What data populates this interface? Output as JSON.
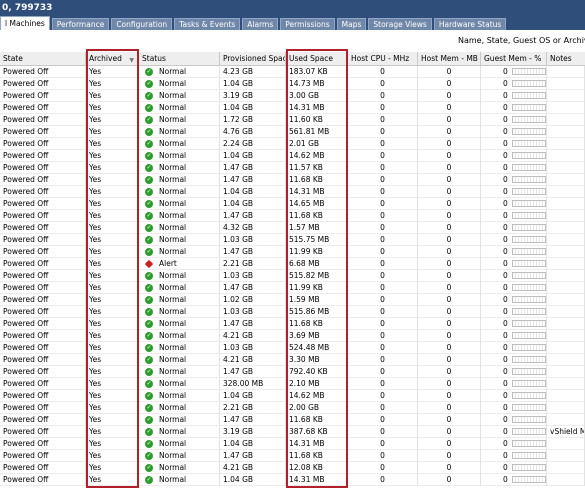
{
  "window": {
    "title": "0, 799733"
  },
  "tabs": [
    {
      "label": "l Machines",
      "active": true
    },
    {
      "label": "Performance",
      "active": false
    },
    {
      "label": "Configuration",
      "active": false
    },
    {
      "label": "Tasks & Events",
      "active": false
    },
    {
      "label": "Alarms",
      "active": false
    },
    {
      "label": "Permissions",
      "active": false
    },
    {
      "label": "Maps",
      "active": false
    },
    {
      "label": "Storage Views",
      "active": false
    },
    {
      "label": "Hardware Status",
      "active": false
    }
  ],
  "filter": {
    "label": "Name, State, Guest OS or Archived co"
  },
  "columns": {
    "state": "State",
    "archived": "Archived",
    "status": "Status",
    "provisioned": "Provisioned Space",
    "used": "Used Space",
    "hostcpu": "Host CPU - MHz",
    "hostmem": "Host Mem - MB",
    "guestmem": "Guest Mem - %",
    "notes": "Notes"
  },
  "rows": [
    {
      "state": "Powered Off",
      "archived": "Yes",
      "status": "Normal",
      "provisioned": "4.23 GB",
      "used": "183.07 KB",
      "hostcpu": "0",
      "hostmem": "0",
      "guestmem": "0",
      "notes": ""
    },
    {
      "state": "Powered Off",
      "archived": "Yes",
      "status": "Normal",
      "provisioned": "1.04 GB",
      "used": "14.73 MB",
      "hostcpu": "0",
      "hostmem": "0",
      "guestmem": "0",
      "notes": ""
    },
    {
      "state": "Powered Off",
      "archived": "Yes",
      "status": "Normal",
      "provisioned": "3.19 GB",
      "used": "3.00 GB",
      "hostcpu": "0",
      "hostmem": "0",
      "guestmem": "0",
      "notes": ""
    },
    {
      "state": "Powered Off",
      "archived": "Yes",
      "status": "Normal",
      "provisioned": "1.04 GB",
      "used": "14.31 MB",
      "hostcpu": "0",
      "hostmem": "0",
      "guestmem": "0",
      "notes": ""
    },
    {
      "state": "Powered Off",
      "archived": "Yes",
      "status": "Normal",
      "provisioned": "1.72 GB",
      "used": "11.60 KB",
      "hostcpu": "0",
      "hostmem": "0",
      "guestmem": "0",
      "notes": ""
    },
    {
      "state": "Powered Off",
      "archived": "Yes",
      "status": "Normal",
      "provisioned": "4.76 GB",
      "used": "561.81 MB",
      "hostcpu": "0",
      "hostmem": "0",
      "guestmem": "0",
      "notes": ""
    },
    {
      "state": "Powered Off",
      "archived": "Yes",
      "status": "Normal",
      "provisioned": "2.24 GB",
      "used": "2.01 GB",
      "hostcpu": "0",
      "hostmem": "0",
      "guestmem": "0",
      "notes": ""
    },
    {
      "state": "Powered Off",
      "archived": "Yes",
      "status": "Normal",
      "provisioned": "1.04 GB",
      "used": "14.62 MB",
      "hostcpu": "0",
      "hostmem": "0",
      "guestmem": "0",
      "notes": ""
    },
    {
      "state": "Powered Off",
      "archived": "Yes",
      "status": "Normal",
      "provisioned": "1.47 GB",
      "used": "11.57 KB",
      "hostcpu": "0",
      "hostmem": "0",
      "guestmem": "0",
      "notes": ""
    },
    {
      "state": "Powered Off",
      "archived": "Yes",
      "status": "Normal",
      "provisioned": "1.47 GB",
      "used": "11.68 KB",
      "hostcpu": "0",
      "hostmem": "0",
      "guestmem": "0",
      "notes": ""
    },
    {
      "state": "Powered Off",
      "archived": "Yes",
      "status": "Normal",
      "provisioned": "1.04 GB",
      "used": "14.31 MB",
      "hostcpu": "0",
      "hostmem": "0",
      "guestmem": "0",
      "notes": ""
    },
    {
      "state": "Powered Off",
      "archived": "Yes",
      "status": "Normal",
      "provisioned": "1.04 GB",
      "used": "14.65 MB",
      "hostcpu": "0",
      "hostmem": "0",
      "guestmem": "0",
      "notes": ""
    },
    {
      "state": "Powered Off",
      "archived": "Yes",
      "status": "Normal",
      "provisioned": "1.47 GB",
      "used": "11.68 KB",
      "hostcpu": "0",
      "hostmem": "0",
      "guestmem": "0",
      "notes": ""
    },
    {
      "state": "Powered Off",
      "archived": "Yes",
      "status": "Normal",
      "provisioned": "4.32 GB",
      "used": "1.57 MB",
      "hostcpu": "0",
      "hostmem": "0",
      "guestmem": "0",
      "notes": ""
    },
    {
      "state": "Powered Off",
      "archived": "Yes",
      "status": "Normal",
      "provisioned": "1.03 GB",
      "used": "515.75 MB",
      "hostcpu": "0",
      "hostmem": "0",
      "guestmem": "0",
      "notes": ""
    },
    {
      "state": "Powered Off",
      "archived": "Yes",
      "status": "Normal",
      "provisioned": "1.47 GB",
      "used": "11.99 KB",
      "hostcpu": "0",
      "hostmem": "0",
      "guestmem": "0",
      "notes": ""
    },
    {
      "state": "Powered Off",
      "archived": "Yes",
      "status": "Alert",
      "provisioned": "2.21 GB",
      "used": "6.68 MB",
      "hostcpu": "0",
      "hostmem": "0",
      "guestmem": "0",
      "notes": ""
    },
    {
      "state": "Powered Off",
      "archived": "Yes",
      "status": "Normal",
      "provisioned": "1.03 GB",
      "used": "515.82 MB",
      "hostcpu": "0",
      "hostmem": "0",
      "guestmem": "0",
      "notes": ""
    },
    {
      "state": "Powered Off",
      "archived": "Yes",
      "status": "Normal",
      "provisioned": "1.47 GB",
      "used": "11.99 KB",
      "hostcpu": "0",
      "hostmem": "0",
      "guestmem": "0",
      "notes": ""
    },
    {
      "state": "Powered Off",
      "archived": "Yes",
      "status": "Normal",
      "provisioned": "1.02 GB",
      "used": "1.59 MB",
      "hostcpu": "0",
      "hostmem": "0",
      "guestmem": "0",
      "notes": ""
    },
    {
      "state": "Powered Off",
      "archived": "Yes",
      "status": "Normal",
      "provisioned": "1.03 GB",
      "used": "515.86 MB",
      "hostcpu": "0",
      "hostmem": "0",
      "guestmem": "0",
      "notes": ""
    },
    {
      "state": "Powered Off",
      "archived": "Yes",
      "status": "Normal",
      "provisioned": "1.47 GB",
      "used": "11.68 KB",
      "hostcpu": "0",
      "hostmem": "0",
      "guestmem": "0",
      "notes": ""
    },
    {
      "state": "Powered Off",
      "archived": "Yes",
      "status": "Normal",
      "provisioned": "4.21 GB",
      "used": "3.69 MB",
      "hostcpu": "0",
      "hostmem": "0",
      "guestmem": "0",
      "notes": ""
    },
    {
      "state": "Powered Off",
      "archived": "Yes",
      "status": "Normal",
      "provisioned": "1.03 GB",
      "used": "524.48 MB",
      "hostcpu": "0",
      "hostmem": "0",
      "guestmem": "0",
      "notes": ""
    },
    {
      "state": "Powered Off",
      "archived": "Yes",
      "status": "Normal",
      "provisioned": "4.21 GB",
      "used": "3.30 MB",
      "hostcpu": "0",
      "hostmem": "0",
      "guestmem": "0",
      "notes": ""
    },
    {
      "state": "Powered Off",
      "archived": "Yes",
      "status": "Normal",
      "provisioned": "1.47 GB",
      "used": "792.40 KB",
      "hostcpu": "0",
      "hostmem": "0",
      "guestmem": "0",
      "notes": ""
    },
    {
      "state": "Powered Off",
      "archived": "Yes",
      "status": "Normal",
      "provisioned": "328.00 MB",
      "used": "2.10 MB",
      "hostcpu": "0",
      "hostmem": "0",
      "guestmem": "0",
      "notes": ""
    },
    {
      "state": "Powered Off",
      "archived": "Yes",
      "status": "Normal",
      "provisioned": "1.04 GB",
      "used": "14.62 MB",
      "hostcpu": "0",
      "hostmem": "0",
      "guestmem": "0",
      "notes": ""
    },
    {
      "state": "Powered Off",
      "archived": "Yes",
      "status": "Normal",
      "provisioned": "2.21 GB",
      "used": "2.00 GB",
      "hostcpu": "0",
      "hostmem": "0",
      "guestmem": "0",
      "notes": ""
    },
    {
      "state": "Powered Off",
      "archived": "Yes",
      "status": "Normal",
      "provisioned": "1.47 GB",
      "used": "11.68 KB",
      "hostcpu": "0",
      "hostmem": "0",
      "guestmem": "0",
      "notes": ""
    },
    {
      "state": "Powered Off",
      "archived": "Yes",
      "status": "Normal",
      "provisioned": "3.19 GB",
      "used": "387.68 KB",
      "hostcpu": "0",
      "hostmem": "0",
      "guestmem": "0",
      "notes": "vShield M"
    },
    {
      "state": "Powered Off",
      "archived": "Yes",
      "status": "Normal",
      "provisioned": "1.04 GB",
      "used": "14.31 MB",
      "hostcpu": "0",
      "hostmem": "0",
      "guestmem": "0",
      "notes": ""
    },
    {
      "state": "Powered Off",
      "archived": "Yes",
      "status": "Normal",
      "provisioned": "1.47 GB",
      "used": "11.68 KB",
      "hostcpu": "0",
      "hostmem": "0",
      "guestmem": "0",
      "notes": ""
    },
    {
      "state": "Powered Off",
      "archived": "Yes",
      "status": "Normal",
      "provisioned": "4.21 GB",
      "used": "12.08 KB",
      "hostcpu": "0",
      "hostmem": "0",
      "guestmem": "0",
      "notes": ""
    },
    {
      "state": "Powered Off",
      "archived": "Yes",
      "status": "Normal",
      "provisioned": "1.04 GB",
      "used": "14.31 MB",
      "hostcpu": "0",
      "hostmem": "0",
      "guestmem": "0",
      "notes": ""
    }
  ]
}
